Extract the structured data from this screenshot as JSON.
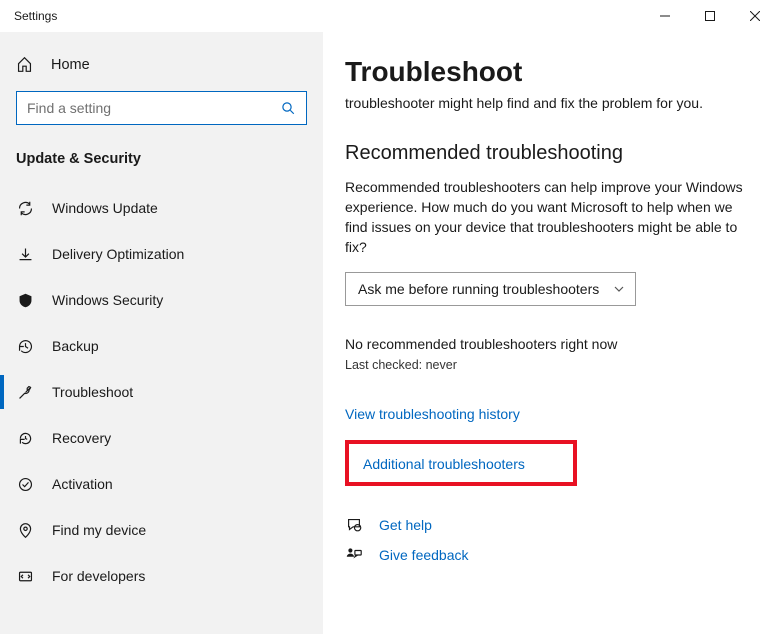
{
  "window": {
    "title": "Settings"
  },
  "sidebar": {
    "home": "Home",
    "search_placeholder": "Find a setting",
    "category": "Update & Security",
    "items": [
      {
        "label": "Windows Update"
      },
      {
        "label": "Delivery Optimization"
      },
      {
        "label": "Windows Security"
      },
      {
        "label": "Backup"
      },
      {
        "label": "Troubleshoot"
      },
      {
        "label": "Recovery"
      },
      {
        "label": "Activation"
      },
      {
        "label": "Find my device"
      },
      {
        "label": "For developers"
      }
    ]
  },
  "main": {
    "title": "Troubleshoot",
    "intro": "troubleshooter might help find and fix the problem for you.",
    "rec_heading": "Recommended troubleshooting",
    "rec_body": "Recommended troubleshooters can help improve your Windows experience. How much do you want Microsoft to help when we find issues on your device that troubleshooters might be able to fix?",
    "dropdown_value": "Ask me before running troubleshooters",
    "no_rec": "No recommended troubleshooters right now",
    "last_checked": "Last checked: never",
    "history_link": "View troubleshooting history",
    "additional_link": "Additional troubleshooters",
    "get_help": "Get help",
    "give_feedback": "Give feedback"
  }
}
